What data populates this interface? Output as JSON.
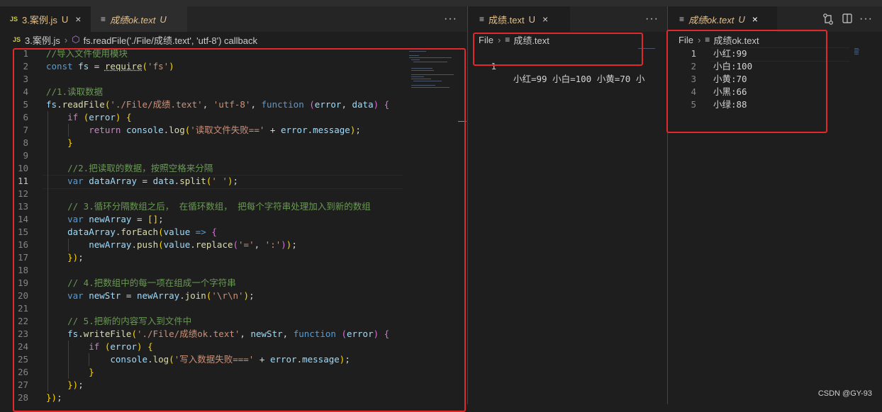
{
  "pane1": {
    "tab_active": {
      "label": "3.案例.js",
      "status": "U",
      "icon": "JS",
      "close": "×"
    },
    "tab2": {
      "label": "成绩ok.text",
      "status": "U"
    },
    "more": "···",
    "breadcrumb": {
      "file": "3.案例.js",
      "symbol": "fs.readFile('./File/成绩.text', 'utf-8') callback"
    },
    "lines": [
      {
        "n": "1",
        "t": "//导入文件使用模块"
      },
      {
        "n": "2",
        "t": "const fs = require('fs')"
      },
      {
        "n": "3",
        "t": ""
      },
      {
        "n": "4",
        "t": "//1.读取数据"
      },
      {
        "n": "5",
        "t": "fs.readFile('./File/成绩.text', 'utf-8', function (error, data) {"
      },
      {
        "n": "6",
        "t": "    if (error) {"
      },
      {
        "n": "7",
        "t": "        return console.log('读取文件失败==' + error.message);"
      },
      {
        "n": "8",
        "t": "    }"
      },
      {
        "n": "9",
        "t": ""
      },
      {
        "n": "10",
        "t": "    //2.把读取的数据，按照空格来分隔"
      },
      {
        "n": "11",
        "t": "    var dataArray = data.split(' ');"
      },
      {
        "n": "12",
        "t": ""
      },
      {
        "n": "13",
        "t": "    // 3.循环分隔数组之后， 在循环数组， 把每个字符串处理加入到新的数组"
      },
      {
        "n": "14",
        "t": "    var newArray = [];"
      },
      {
        "n": "15",
        "t": "    dataArray.forEach(value => {"
      },
      {
        "n": "16",
        "t": "        newArray.push(value.replace('=', ':'));"
      },
      {
        "n": "17",
        "t": "    });"
      },
      {
        "n": "18",
        "t": ""
      },
      {
        "n": "19",
        "t": "    // 4.把数组中的每一项在组成一个字符串"
      },
      {
        "n": "20",
        "t": "    var newStr = newArray.join('\\r\\n');"
      },
      {
        "n": "21",
        "t": ""
      },
      {
        "n": "22",
        "t": "    // 5.把新的内容写入到文件中"
      },
      {
        "n": "23",
        "t": "    fs.writeFile('./File/成绩ok.text', newStr, function (error) {"
      },
      {
        "n": "24",
        "t": "        if (error) {"
      },
      {
        "n": "25",
        "t": "            console.log('写入数据失败===' + error.message);"
      },
      {
        "n": "26",
        "t": "        }"
      },
      {
        "n": "27",
        "t": "    });"
      },
      {
        "n": "28",
        "t": "});"
      }
    ]
  },
  "pane2": {
    "tab": {
      "label": "成绩.text",
      "status": "U",
      "close": "×"
    },
    "more": "···",
    "breadcrumb": {
      "folder": "File",
      "file": "成绩.text"
    },
    "line": {
      "n": "1",
      "t": "小红=99 小白=100 小黄=70 小"
    }
  },
  "pane3": {
    "tab": {
      "label": "成绩ok.text",
      "status": "U",
      "close": "×"
    },
    "more": "···",
    "breadcrumb": {
      "folder": "File",
      "file": "成绩ok.text"
    },
    "lines": [
      {
        "n": "1",
        "t": "小红:99"
      },
      {
        "n": "2",
        "t": "小白:100"
      },
      {
        "n": "3",
        "t": "小黄:70"
      },
      {
        "n": "4",
        "t": "小黑:66"
      },
      {
        "n": "5",
        "t": "小绿:88"
      }
    ]
  },
  "watermark": "CSDN @GY-93",
  "colors": {
    "highlight_box": "#e0282d",
    "untracked": "#e2c08d",
    "tab_green": "#73c991"
  }
}
